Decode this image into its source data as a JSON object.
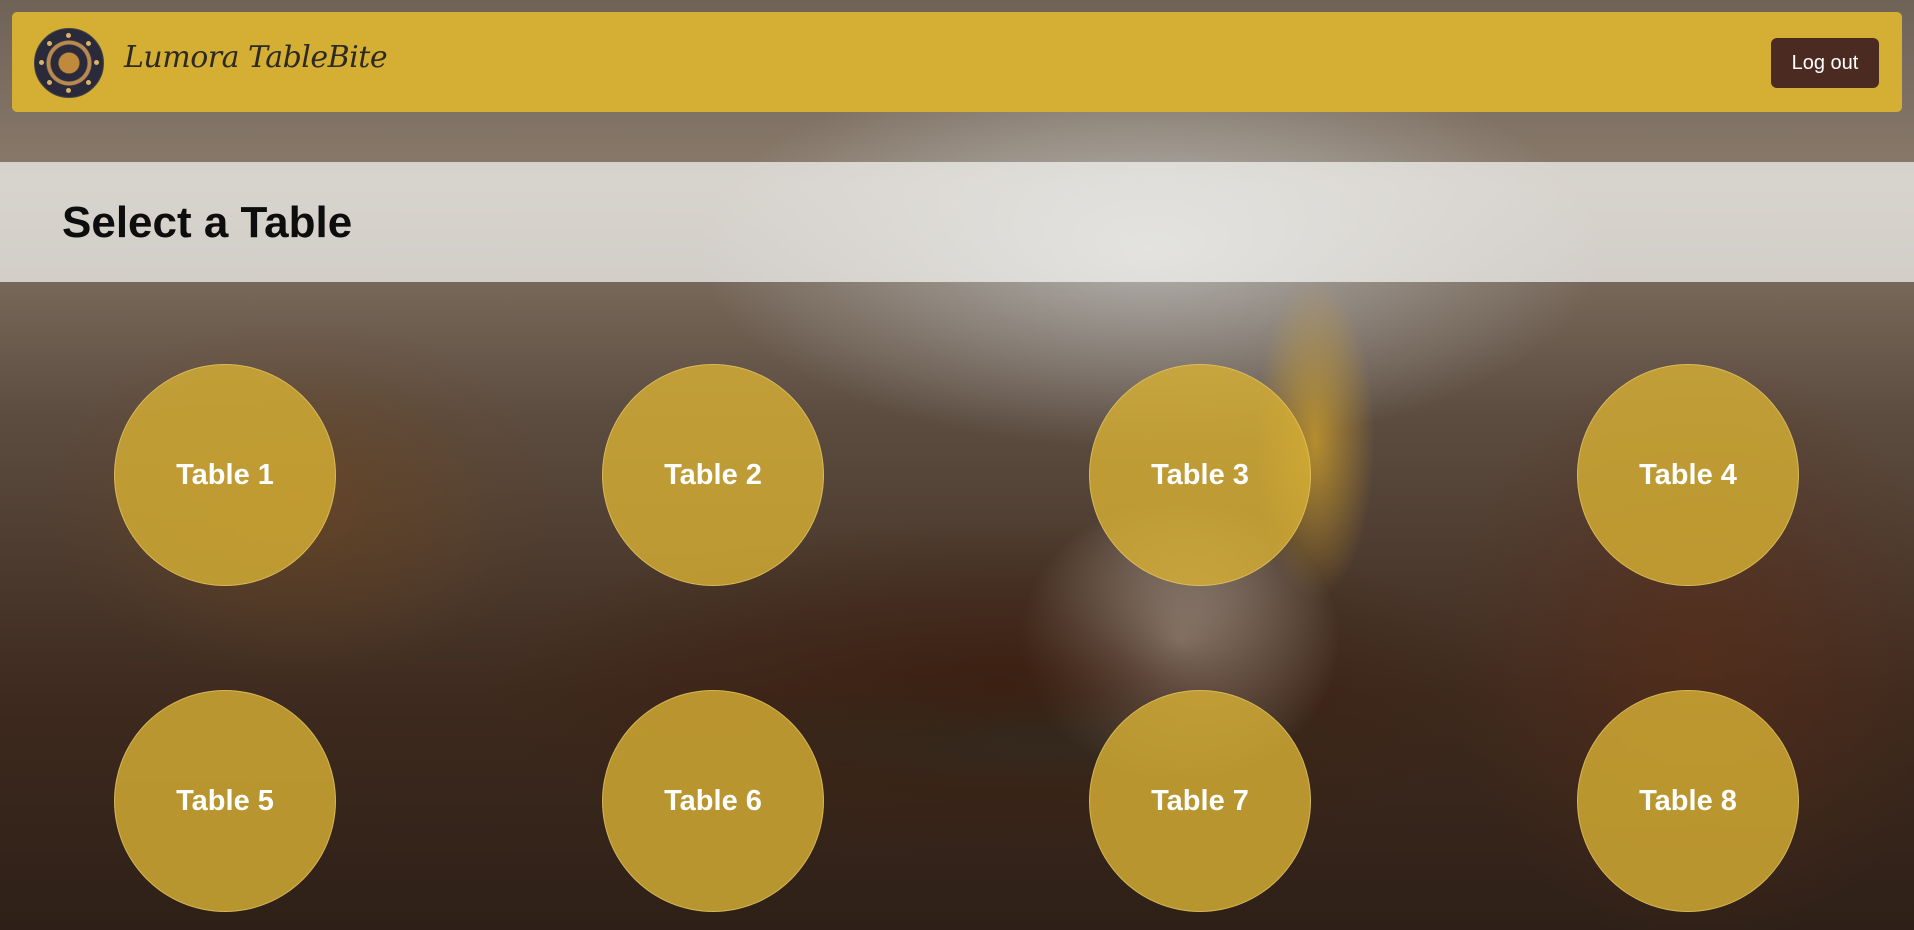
{
  "navbar": {
    "brand": "Lumora TableBite",
    "logout_label": "Log out"
  },
  "page": {
    "title": "Select a Table"
  },
  "tables": [
    {
      "label": "Table 1"
    },
    {
      "label": "Table 2"
    },
    {
      "label": "Table 3"
    },
    {
      "label": "Table 4"
    },
    {
      "label": "Table 5"
    },
    {
      "label": "Table 6"
    },
    {
      "label": "Table 7"
    },
    {
      "label": "Table 8"
    }
  ],
  "colors": {
    "navbar": "#d5af34",
    "logout_button": "#4b2b21",
    "table_circle": "#d5af34"
  }
}
